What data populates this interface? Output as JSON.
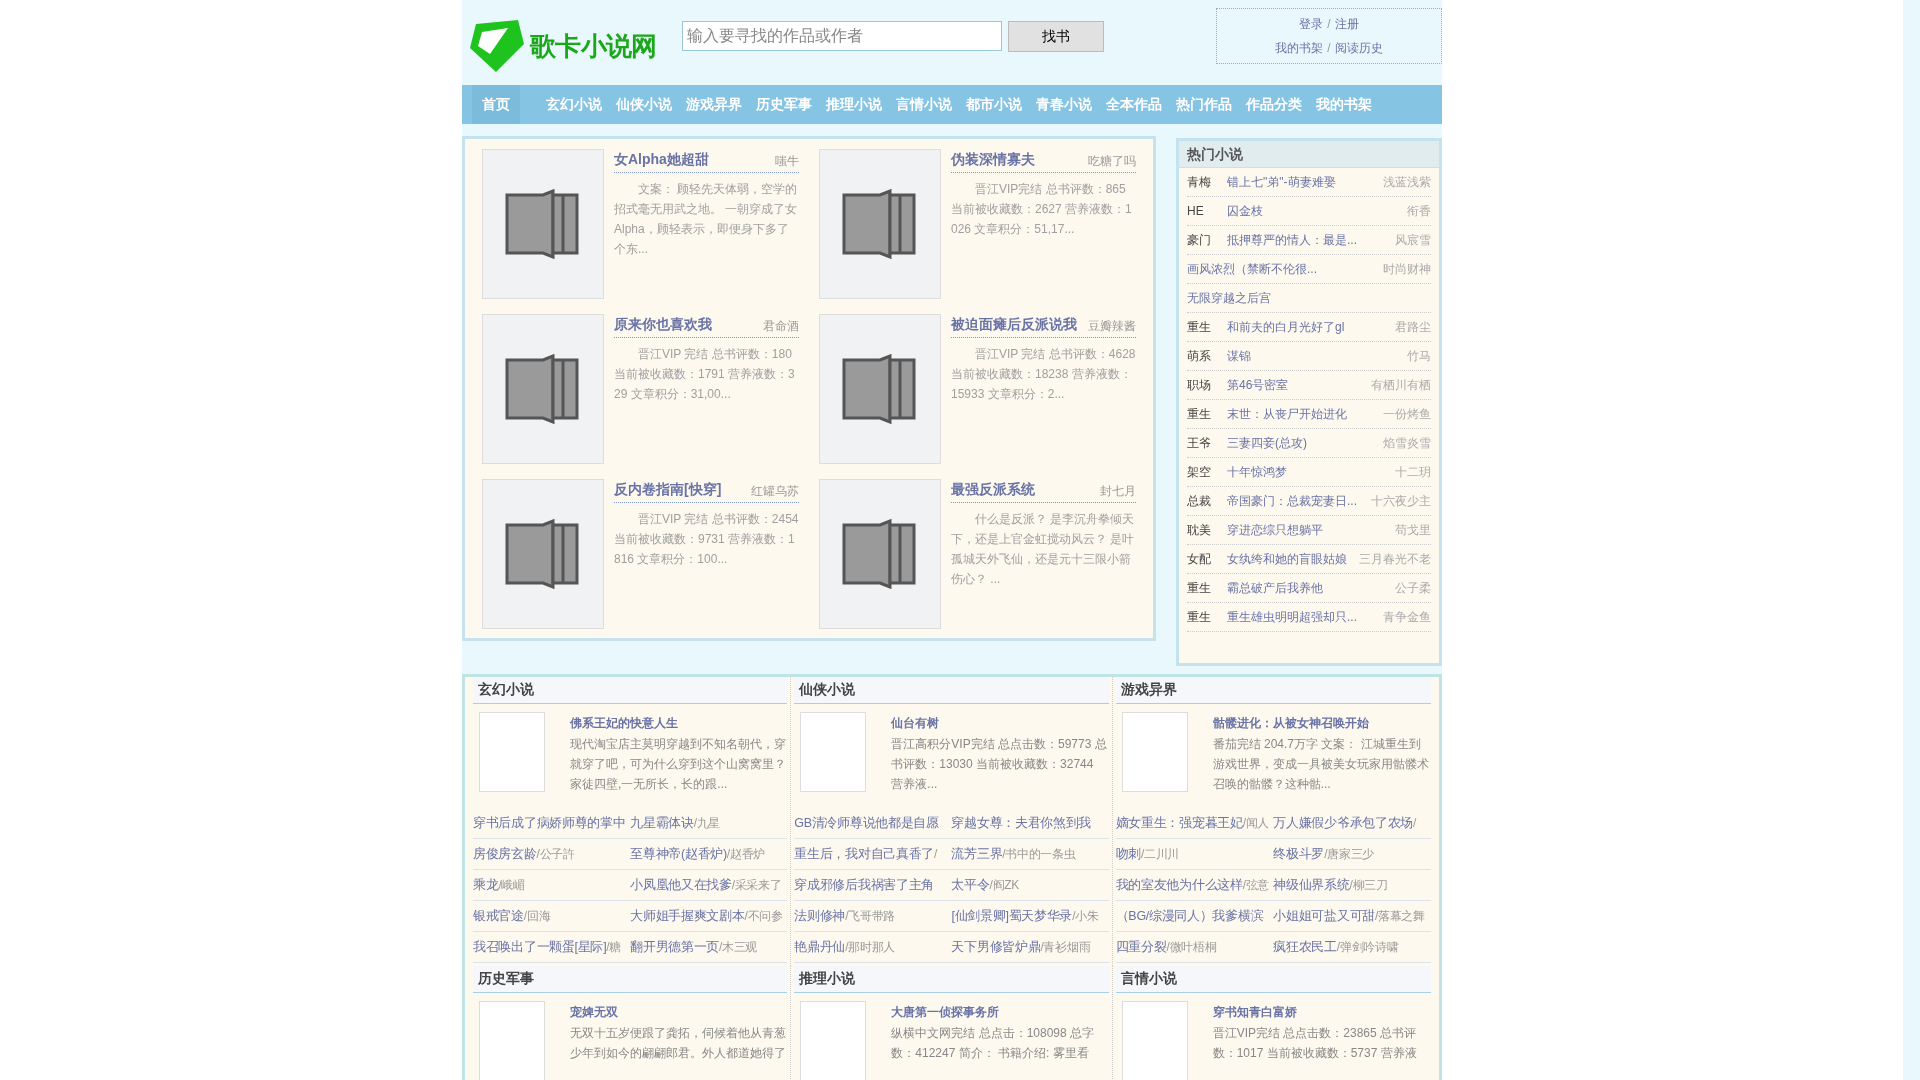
{
  "logo": {
    "text": "歌卡小说网"
  },
  "search": {
    "placeholder": "输入要寻找的作品或作者",
    "button": "找书"
  },
  "user_links": [
    {
      "left": "登录",
      "separator": "/",
      "right": "注册"
    },
    {
      "left": "我的书架",
      "separator": "/",
      "right": "阅读历史"
    }
  ],
  "nav": [
    {
      "label": "首页",
      "selected": true
    },
    {
      "label": "玄幻小说",
      "selected": false
    },
    {
      "label": "仙侠小说",
      "selected": false
    },
    {
      "label": "游戏异界",
      "selected": false
    },
    {
      "label": "历史军事",
      "selected": false
    },
    {
      "label": "推理小说",
      "selected": false
    },
    {
      "label": "言情小说",
      "selected": false
    },
    {
      "label": "都市小说",
      "selected": false
    },
    {
      "label": "青春小说",
      "selected": false
    },
    {
      "label": "全本作品",
      "selected": false
    },
    {
      "label": "热门作品",
      "selected": false
    },
    {
      "label": "作品分类",
      "selected": false
    },
    {
      "label": "我的书架",
      "selected": false
    }
  ],
  "featured": [
    {
      "title": "女Alpha她超甜",
      "author": "嗤牛",
      "desc": "文案： 顾轻先天体弱，空学的招式毫无用武之地。 一朝穿成了女Alpha，顾轻表示，即便身下多了个东..."
    },
    {
      "title": "伪装深情寡夫",
      "author": "吃糖了吗",
      "desc": "晋江VIP完结 总书评数：865 当前被收藏数：2627 营养液数：1026 文章积分：51,17..."
    },
    {
      "title": "原来你也喜欢我",
      "author": "君命酒",
      "desc": "晋江VIP 完结 总书评数：180 当前被收藏数：1791 营养液数：329 文章积分：31,00..."
    },
    {
      "title": "被迫面瘫后反派说我",
      "author": "豆瓣辣酱",
      "desc": "晋江VIP 完结 总书评数：4628 当前被收藏数：18238 营养液数：15933 文章积分：2..."
    },
    {
      "title": "反内卷指南[快穿]",
      "author": "红罐乌苏",
      "desc": "晋江VIP 完结 总书评数：2454 当前被收藏数：9731 营养液数：1816 文章积分：100..."
    },
    {
      "title": "最强反派系统",
      "author": "封七月",
      "desc": "什么是反派？ 是李沉舟拳倾天下，还是上官金虹搅动风云？ 是叶孤城天外飞仙，还是元十三限小箭伤心？ ..."
    }
  ],
  "hot": {
    "title": "热门小说",
    "items": [
      {
        "tag": "青梅",
        "title": "错上七\"弟\"-萌妻难娶",
        "author": "浅蓝浅紫"
      },
      {
        "tag": "HE",
        "title": "囚金枝",
        "author": "衔香"
      },
      {
        "tag": "豪门",
        "title": "抵押尊严的情人：最是...",
        "author": "风宸雪"
      },
      {
        "title": "画风浓烈（禁断不伦很...",
        "author": "时尚财神"
      },
      {
        "title": "无限穿越之后宫"
      },
      {
        "tag": "重生",
        "title": "和前夫的白月光好了gl",
        "author": "君路尘"
      },
      {
        "tag": "萌系",
        "title": "谋锦",
        "author": "竹马"
      },
      {
        "tag": "职场",
        "title": "第46号密室",
        "author": "有栖川有栖"
      },
      {
        "tag": "重生",
        "title": "末世：从丧尸开始进化",
        "author": "一份烤鱼"
      },
      {
        "tag": "王爷",
        "title": "三妻四妾(总攻)",
        "author": "焰雪炎雪"
      },
      {
        "tag": "架空",
        "title": "十年惊鸿梦",
        "author": "十二玥"
      },
      {
        "tag": "总裁",
        "title": "帝国豪门：总裁宠妻日...",
        "author": "十六夜少主"
      },
      {
        "tag": "耽美",
        "title": "穿进恋综只想躺平",
        "author": "苟戈里"
      },
      {
        "tag": "女配",
        "title": "女纨绔和她的盲眼姑娘",
        "author": "三月春光不老"
      },
      {
        "tag": "重生",
        "title": "霸总破产后我养他",
        "author": "公子柔"
      },
      {
        "tag": "重生",
        "title": "重生雄虫明明超强却只...",
        "author": "青争金鱼"
      }
    ]
  },
  "sections": [
    {
      "title": "玄幻小说",
      "top": {
        "title": "佛系王妃的快意人生",
        "desc": "现代淘宝店主莫明穿越到不知名朝代，穿就穿了吧，可为什么穿到这个山窝窝里？家徒四壁,一无所长，长的跟..."
      },
      "links": [
        {
          "title": "穿书后成了病娇师尊的掌中"
        },
        {
          "title": "九星霸体诀",
          "author": "/九星"
        },
        {
          "title": "房俊房玄龄",
          "author": "/公子許"
        },
        {
          "title": "至尊神帝(赵香炉)",
          "author": "/赵香炉"
        },
        {
          "title": "乘龙",
          "author": "/峨嵋"
        },
        {
          "title": "小凤凰他又在找爹",
          "author": "/采采来了"
        },
        {
          "title": "银戒官途",
          "author": "/回海"
        },
        {
          "title": "大师姐手握爽文剧本",
          "author": "/不问参"
        },
        {
          "title": "我召唤出了一颗蛋[星际]",
          "author": "/糖"
        },
        {
          "title": "翻开男德第一页",
          "author": "/木三观"
        }
      ]
    },
    {
      "title": "仙侠小说",
      "top": {
        "title": "仙台有树",
        "desc": "晋江高积分VIP完结 总点击数：59773 总书评数：13030 当前被收藏数：32744 营养液..."
      },
      "links": [
        {
          "title": "GB清冷师尊说他都是自愿"
        },
        {
          "title": "穿越女尊：夫君你煞到我"
        },
        {
          "title": "重生后，我对自己真香了",
          "author": "/"
        },
        {
          "title": "流芳三界",
          "author": "/书中的一条虫"
        },
        {
          "title": "穿成邪修后我祸害了主角"
        },
        {
          "title": "太平令",
          "author": "/阎ZK"
        },
        {
          "title": "法则修神",
          "author": "/飞哥带路"
        },
        {
          "title": "[仙剑景卿]蜀天梦华录",
          "author": "/小朱"
        },
        {
          "title": "艳鼎丹仙",
          "author": "/那时那人"
        },
        {
          "title": "天下男修皆炉鼎",
          "author": "/青衫烟雨"
        }
      ]
    },
    {
      "title": "游戏异界",
      "top": {
        "title": "骷髅进化：从被女神召唤开始",
        "desc": "番茄完结 204.7万字 文案： 江城重生到游戏世界，变成一具被美女玩家用骷髅术召唤的骷髅？这种骷..."
      },
      "links": [
        {
          "title": "嫡女重生：强宠暮王妃",
          "author": "/闻人"
        },
        {
          "title": "万人嫌假少爷承包了农场",
          "author": "/"
        },
        {
          "title": "吻刺",
          "author": "/二川川"
        },
        {
          "title": "终极斗罗",
          "author": "/唐家三少"
        },
        {
          "title": "我的室友他为什么这样",
          "author": "/弦意"
        },
        {
          "title": "神级仙界系统",
          "author": "/柳三刀"
        },
        {
          "title": "（BG/综漫同人）我爹横滨"
        },
        {
          "title": "小姐姐可盐又可甜",
          "author": "/落幕之舞"
        },
        {
          "title": "四重分裂",
          "author": "/微叶梧桐"
        },
        {
          "title": "疯狂农民工",
          "author": "/弹剑吟诗啸"
        }
      ]
    },
    {
      "title": "历史军事",
      "top": {
        "title": "宠婢无双",
        "desc": "无双十五岁便跟了龚拓，伺候着他从青葱少年到如今的翩翩郎君。外人都道她得了"
      }
    },
    {
      "title": "推理小说",
      "top": {
        "title": "大唐第一侦探事务所",
        "desc": "纵横中文网完结 总点击：108098 总字数：412247 简介： 书籍介绍: 雾里看"
      }
    },
    {
      "title": "言情小说",
      "top": {
        "title": "穿书知青白富娇",
        "desc": "晋江VIP完结 总点击数：23865 总书评数：1017 当前被收藏数：5737 营养液"
      }
    }
  ]
}
